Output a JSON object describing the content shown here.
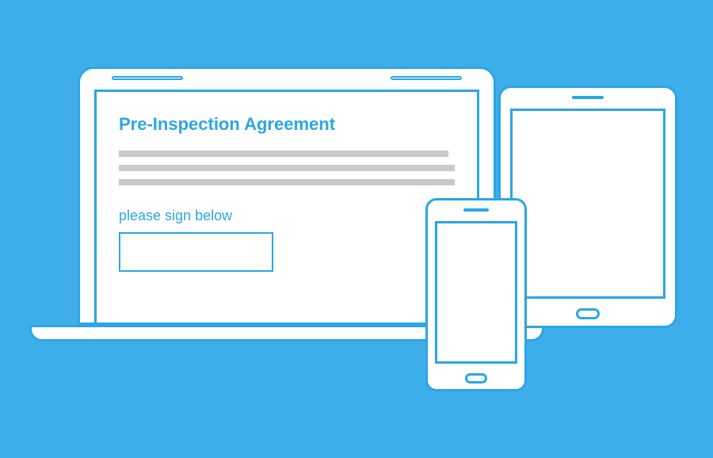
{
  "document": {
    "title": "Pre-Inspection Agreement",
    "sign_label": "please sign below"
  },
  "colors": {
    "background": "#3eaeea",
    "stroke": "#2ba6e4",
    "placeholder": "#c9c9c9",
    "surface": "#ffffff"
  }
}
